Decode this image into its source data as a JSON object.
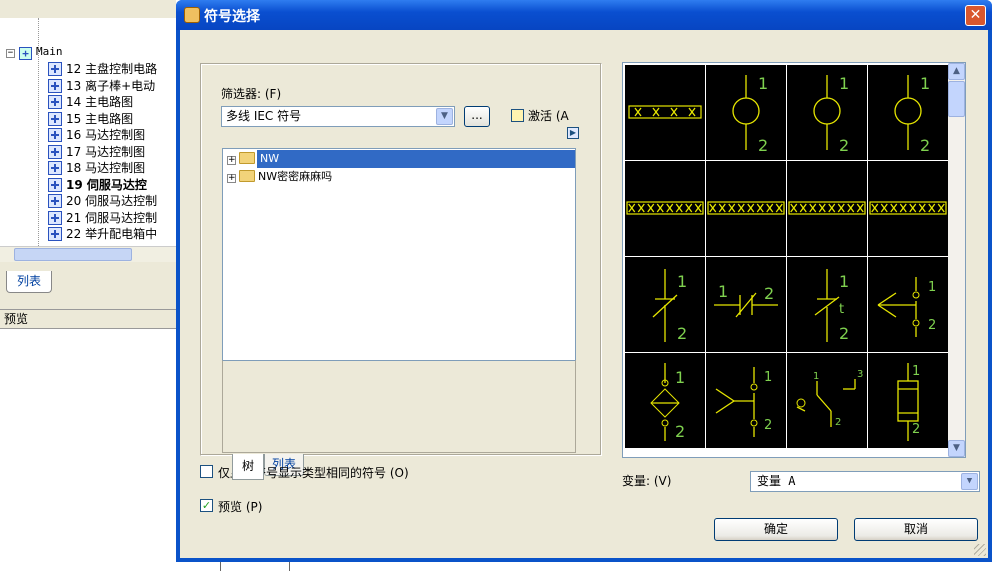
{
  "background": {
    "tree_root": "Main",
    "tree_items": [
      {
        "label": "12 主盘控制电路",
        "bold": false
      },
      {
        "label": "13 离子棒+电动",
        "bold": false
      },
      {
        "label": "14 主电路图",
        "bold": false
      },
      {
        "label": "15 主电路图",
        "bold": false
      },
      {
        "label": "16 马达控制图",
        "bold": false
      },
      {
        "label": "17 马达控制图",
        "bold": false
      },
      {
        "label": "18 马达控制图",
        "bold": false
      },
      {
        "label": "19 伺服马达控",
        "bold": true
      },
      {
        "label": "20 伺服马达控制",
        "bold": false
      },
      {
        "label": "21 伺服马达控制",
        "bold": false
      },
      {
        "label": "22 举升配电箱中",
        "bold": false
      }
    ],
    "tab_list": "列表",
    "preview_title": "预览"
  },
  "dialog": {
    "title": "符号选择",
    "close_label": "✕",
    "filter_label": "筛选器: (F)",
    "filter_value": "多线 IEC 符号",
    "browse_label": "...",
    "activate_label": "激活 (A",
    "tree": [
      {
        "label": "NW",
        "selected": true
      },
      {
        "label": "NW密密麻麻吗",
        "selected": false
      }
    ],
    "tabs": {
      "tree": "树",
      "list": "列表"
    },
    "same_type_label": "仅显示符号显示类型相同的符号 (O)",
    "same_type_checked": false,
    "preview_label": "预览 (P)",
    "preview_checked": true,
    "variant_label": "变量: (V)",
    "variant_value": "变量 A",
    "ok_label": "确定",
    "cancel_label": "取消"
  },
  "symbols": [
    {
      "row": 0,
      "col": 0,
      "kind": "terminal-strip",
      "selected": true
    },
    {
      "row": 0,
      "col": 1,
      "kind": "circle-contact",
      "top": "1",
      "bottom": "2"
    },
    {
      "row": 0,
      "col": 2,
      "kind": "circle-contact",
      "top": "1",
      "bottom": "2"
    },
    {
      "row": 0,
      "col": 3,
      "kind": "circle-contact",
      "top": "1",
      "bottom": "2"
    },
    {
      "row": 1,
      "col": 0,
      "kind": "terminal-strip-long"
    },
    {
      "row": 1,
      "col": 1,
      "kind": "terminal-strip-long"
    },
    {
      "row": 1,
      "col": 2,
      "kind": "terminal-strip-long"
    },
    {
      "row": 1,
      "col": 3,
      "kind": "terminal-strip-long"
    },
    {
      "row": 2,
      "col": 0,
      "kind": "nc-contact",
      "top": "1",
      "bottom": "2"
    },
    {
      "row": 2,
      "col": 1,
      "kind": "horizontal-contact",
      "left": "1",
      "right": "2"
    },
    {
      "row": 2,
      "col": 2,
      "kind": "timed-contact",
      "top": "1",
      "mid": "t",
      "bottom": "2"
    },
    {
      "row": 2,
      "col": 3,
      "kind": "push-contact",
      "top": "1",
      "bottom": "2"
    },
    {
      "row": 3,
      "col": 0,
      "kind": "diamond-contact",
      "top": "1",
      "bottom": "2"
    },
    {
      "row": 3,
      "col": 1,
      "kind": "lever-contact",
      "top": "1",
      "bottom": "2"
    },
    {
      "row": 3,
      "col": 2,
      "kind": "switch-contact",
      "labels": [
        "1",
        "3",
        "2"
      ]
    },
    {
      "row": 3,
      "col": 3,
      "kind": "fuse",
      "top": "1",
      "bottom": "2"
    }
  ],
  "colors": {
    "title_bar": "#0a4fd0",
    "symbol_bg": "#000000",
    "symbol_line": "#e6e600",
    "symbol_text": "#7fd14f",
    "selection": "#316ac5"
  }
}
